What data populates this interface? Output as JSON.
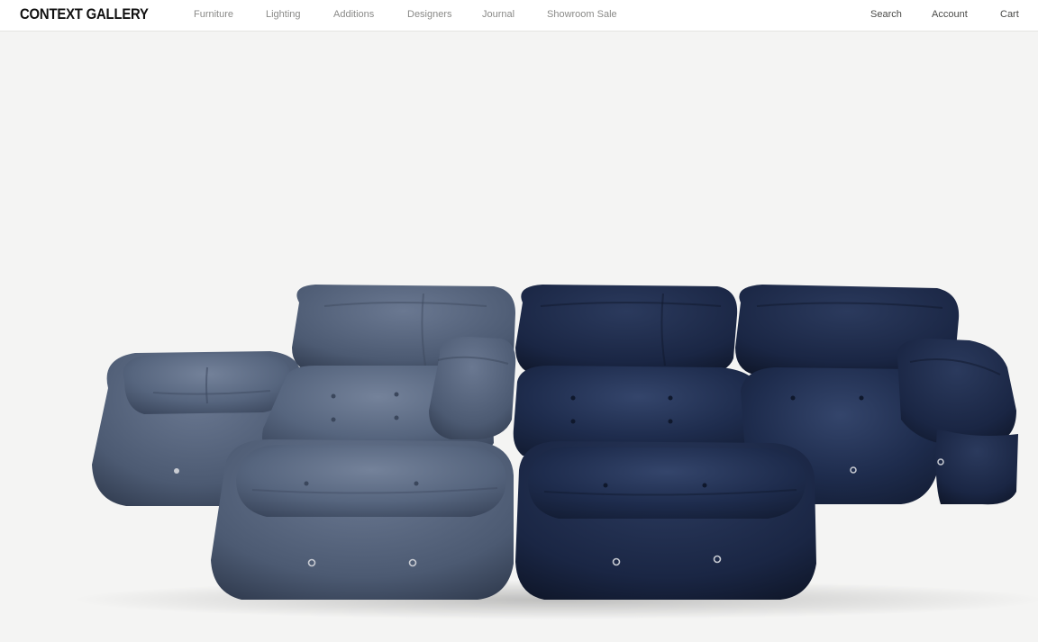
{
  "brand": {
    "logo_text": "CONTEXT GALLERY"
  },
  "nav": {
    "items": [
      {
        "label": "Furniture"
      },
      {
        "label": "Lighting"
      },
      {
        "label": "Additions"
      },
      {
        "label": "Designers"
      },
      {
        "label": "Journal"
      },
      {
        "label": "Showroom Sale"
      }
    ]
  },
  "utility": {
    "search_label": "Search",
    "account_label": "Account",
    "cart_label": "Cart"
  },
  "hero": {
    "colors": {
      "background": "#f4f4f3",
      "slate_blue": "#56657e",
      "navy": "#1e2c4d"
    }
  }
}
